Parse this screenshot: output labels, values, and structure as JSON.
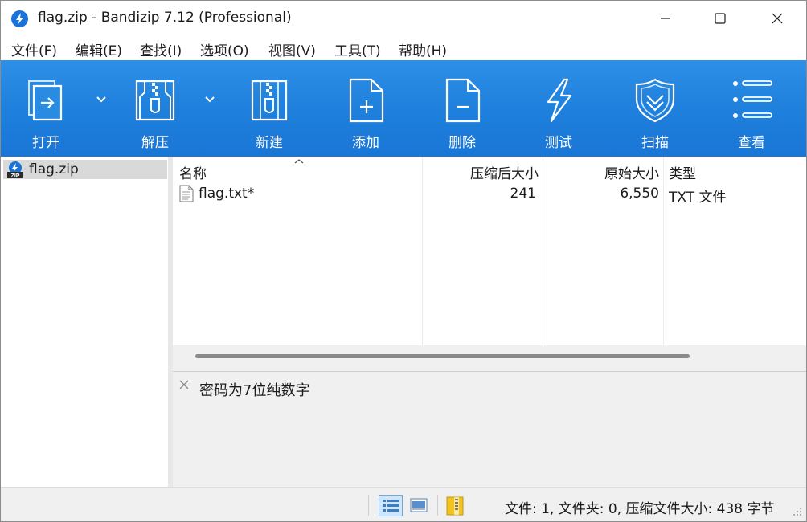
{
  "window": {
    "title": "flag.zip - Bandizip 7.12 (Professional)"
  },
  "menu": [
    {
      "label": "文件(F)"
    },
    {
      "label": "编辑(E)"
    },
    {
      "label": "查找(I)"
    },
    {
      "label": "选项(O)"
    },
    {
      "label": "视图(V)"
    },
    {
      "label": "工具(T)"
    },
    {
      "label": "帮助(H)"
    }
  ],
  "toolbar": {
    "buttons": [
      {
        "label": "打开",
        "icon": "open-icon"
      },
      {
        "label": "解压",
        "icon": "extract-icon"
      },
      {
        "label": "新建",
        "icon": "new-archive-icon"
      },
      {
        "label": "添加",
        "icon": "add-file-icon"
      },
      {
        "label": "删除",
        "icon": "delete-file-icon"
      },
      {
        "label": "测试",
        "icon": "test-lightning-icon"
      },
      {
        "label": "扫描",
        "icon": "scan-shield-icon"
      },
      {
        "label": "查看",
        "icon": "view-list-icon"
      }
    ],
    "colors": {
      "background": "#1e7fdc",
      "foreground": "#ffffff"
    }
  },
  "tree": {
    "items": [
      {
        "label": "flag.zip",
        "icon": "zip-archive-icon",
        "selected": true
      }
    ]
  },
  "filelist": {
    "columns": [
      "名称",
      "压缩后大小",
      "原始大小",
      "类型"
    ],
    "rows": [
      {
        "name": "flag.txt*",
        "compressed": "241",
        "original": "6,550",
        "type": "TXT 文件",
        "icon": "text-file-icon"
      }
    ]
  },
  "comment": {
    "text": "密码为7位纯数字"
  },
  "statusbar": {
    "text": "文件: 1, 文件夹: 0, 压缩文件大小: 438 字节"
  }
}
